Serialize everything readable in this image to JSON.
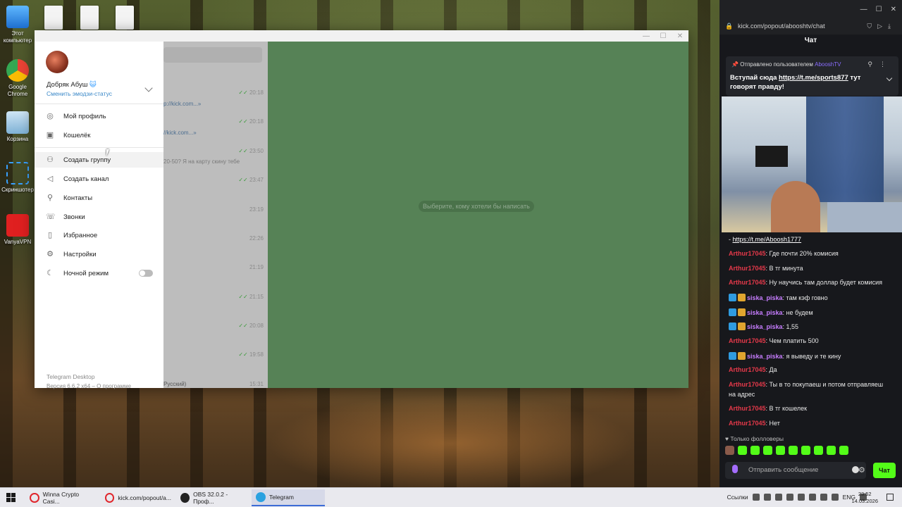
{
  "desktop": {
    "icons": [
      {
        "label": "Этот компьютер"
      },
      {
        "label": "Google Chrome"
      },
      {
        "label": "Корзина"
      },
      {
        "label": "Скриншотер"
      },
      {
        "label": "VanyaVPN"
      }
    ]
  },
  "telegram": {
    "window_controls": [
      "—",
      "☐",
      "✕"
    ],
    "user": {
      "name": "Добряк Абуш",
      "emoji": "😺",
      "status_link": "Сменить эмодзи-статус"
    },
    "menu": [
      {
        "label": "Мой профиль",
        "icon": "user-circle-icon"
      },
      {
        "label": "Кошелёк",
        "icon": "wallet-icon"
      },
      {
        "label": "Создать группу",
        "icon": "group-icon"
      },
      {
        "label": "Создать канал",
        "icon": "megaphone-icon"
      },
      {
        "label": "Контакты",
        "icon": "contact-icon"
      },
      {
        "label": "Звонки",
        "icon": "phone-icon"
      },
      {
        "label": "Избранное",
        "icon": "bookmark-icon"
      },
      {
        "label": "Настройки",
        "icon": "gear-icon"
      },
      {
        "label": "Ночной режим",
        "icon": "moon-icon",
        "toggle": false
      }
    ],
    "footer": {
      "app": "Telegram Desktop",
      "version": "Версия 6.6.2 x64 – О программе"
    },
    "chat_list": [
      {
        "link": "",
        "time": "20:18",
        "check": true
      },
      {
        "link": "p://kick.com...»",
        "time": "",
        "check": false
      },
      {
        "link": "",
        "time": "20:18",
        "check": true
      },
      {
        "link": "//kick.com...»",
        "time": "",
        "check": false
      },
      {
        "link": "",
        "time": "23:50",
        "check": true
      },
      {
        "link": "20-50? Я на карту скину тебе",
        "time": "",
        "check": false
      },
      {
        "link": "",
        "time": "23:47",
        "check": true
      },
      {
        "link": "",
        "time": "23:19",
        "check": false
      },
      {
        "link": "",
        "time": "22:26",
        "check": false
      },
      {
        "link": "",
        "time": "21:19",
        "check": false
      },
      {
        "link": "",
        "time": "21:15",
        "check": true
      },
      {
        "link": "",
        "time": "20:08",
        "check": true
      },
      {
        "link": "",
        "time": "19:58",
        "check": true
      },
      {
        "link": "Русский)",
        "time": "15:31",
        "check": false
      }
    ],
    "placeholder": "Выберите, кому хотели бы написать"
  },
  "kick": {
    "url": "kick.com/popout/abooshtv/chat",
    "title": "Чат",
    "pinned": {
      "header_prefix": "Отправлено пользователем",
      "header_user": "AbooshTV",
      "body_text": "Вступай сюда",
      "body_link": "https://t.me/sports877",
      "body_suffix": "тут говорят правду!"
    },
    "messages": [
      {
        "user": "",
        "text": "- ",
        "link": "https://t.me/Aboosh1777",
        "color": "none",
        "badges": false
      },
      {
        "user": "Arthur17045",
        "text": ": Где почти 20% комисия",
        "color": "red",
        "badges": false
      },
      {
        "user": "Arthur17045",
        "text": ": В тг минута",
        "color": "red",
        "badges": false
      },
      {
        "user": "Arthur17045",
        "text": ": Ну научись там доллар будет комисия",
        "color": "red",
        "badges": false
      },
      {
        "user": "siska_piska",
        "text": ": там кэф говно",
        "color": "purple",
        "badges": true
      },
      {
        "user": "siska_piska",
        "text": ": не будем",
        "color": "purple",
        "badges": true
      },
      {
        "user": "siska_piska",
        "text": ": 1,55",
        "color": "purple",
        "badges": true
      },
      {
        "user": "Arthur17045",
        "text": ": Чем платить 500",
        "color": "red",
        "badges": false
      },
      {
        "user": "siska_piska",
        "text": ": я выведу и те кину",
        "color": "purple",
        "badges": true
      },
      {
        "user": "Arthur17045",
        "text": ": Да",
        "color": "red",
        "badges": false
      },
      {
        "user": "Arthur17045",
        "text": ": Ты в то покупаеш и потом отправляеш",
        "color": "red",
        "badges": false
      },
      {
        "user": "",
        "text": "на адрес",
        "color": "none",
        "badges": false
      },
      {
        "user": "Arthur17045",
        "text": ": В тг кошелек",
        "color": "red",
        "badges": false
      },
      {
        "user": "Arthur17045",
        "text": ": Нет",
        "color": "red",
        "badges": false
      }
    ],
    "followers_only": "Только фолловеры",
    "input_placeholder": "Отправить сообщение",
    "send_label": "Чат",
    "accent": "#53fc18"
  },
  "taskbar": {
    "tasks": [
      {
        "label": "Winna Crypto Casi...",
        "icon": "opera-icon"
      },
      {
        "label": "kick.com/popout/a...",
        "icon": "opera-icon"
      },
      {
        "label": "OBS 32.0.2 - Проф...",
        "icon": "obs-icon"
      },
      {
        "label": "Telegram",
        "icon": "telegram-icon"
      }
    ],
    "links_label": "Ссылки",
    "lang": "ENG",
    "time": "23:52",
    "date": "14.03.2026"
  }
}
